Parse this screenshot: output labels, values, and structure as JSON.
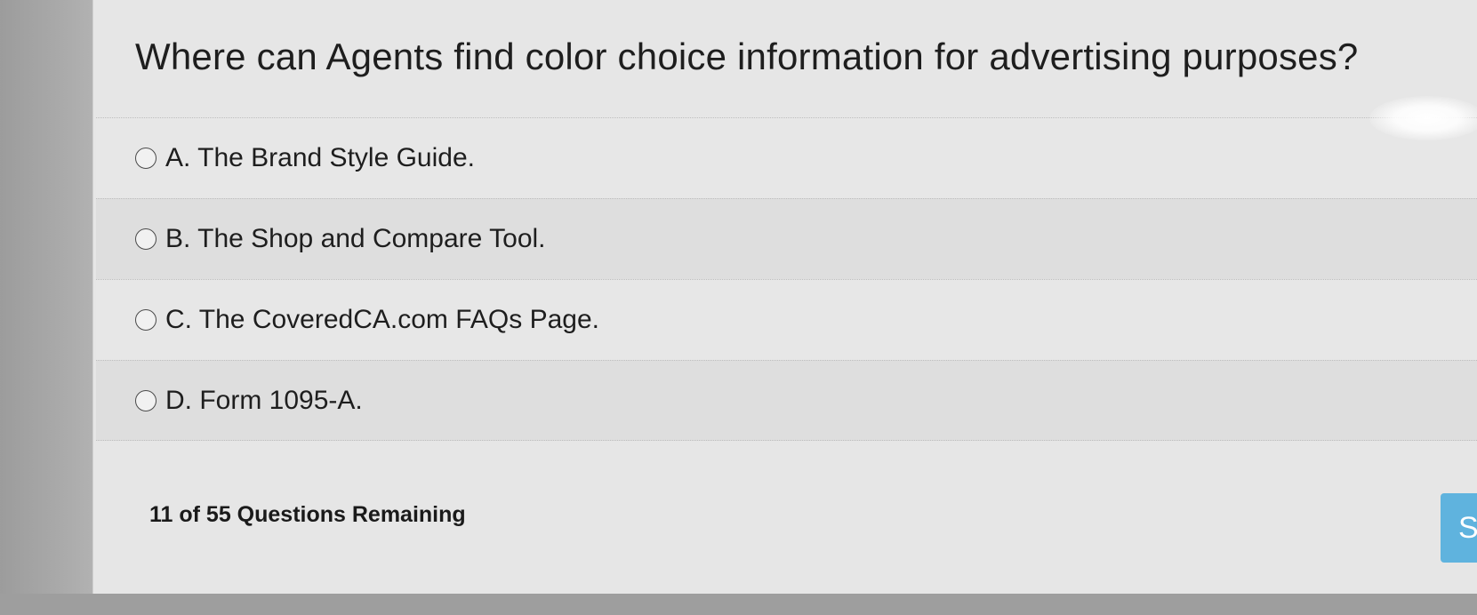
{
  "question": {
    "text": "Where can Agents find color choice information for advertising purposes?"
  },
  "options": [
    {
      "label": "A. The Brand Style Guide.",
      "selected": false
    },
    {
      "label": "B. The Shop and Compare Tool.",
      "selected": false
    },
    {
      "label": "C. The CoveredCA.com FAQs Page.",
      "selected": false
    },
    {
      "label": "D. Form 1095-A.",
      "selected": false
    }
  ],
  "progress": {
    "remaining_text": "11 of 55 Questions Remaining"
  },
  "submit": {
    "label": "S"
  },
  "colors": {
    "panel": "#e6e6e6",
    "accent": "#5fb3de",
    "text": "#1e1e1e"
  }
}
